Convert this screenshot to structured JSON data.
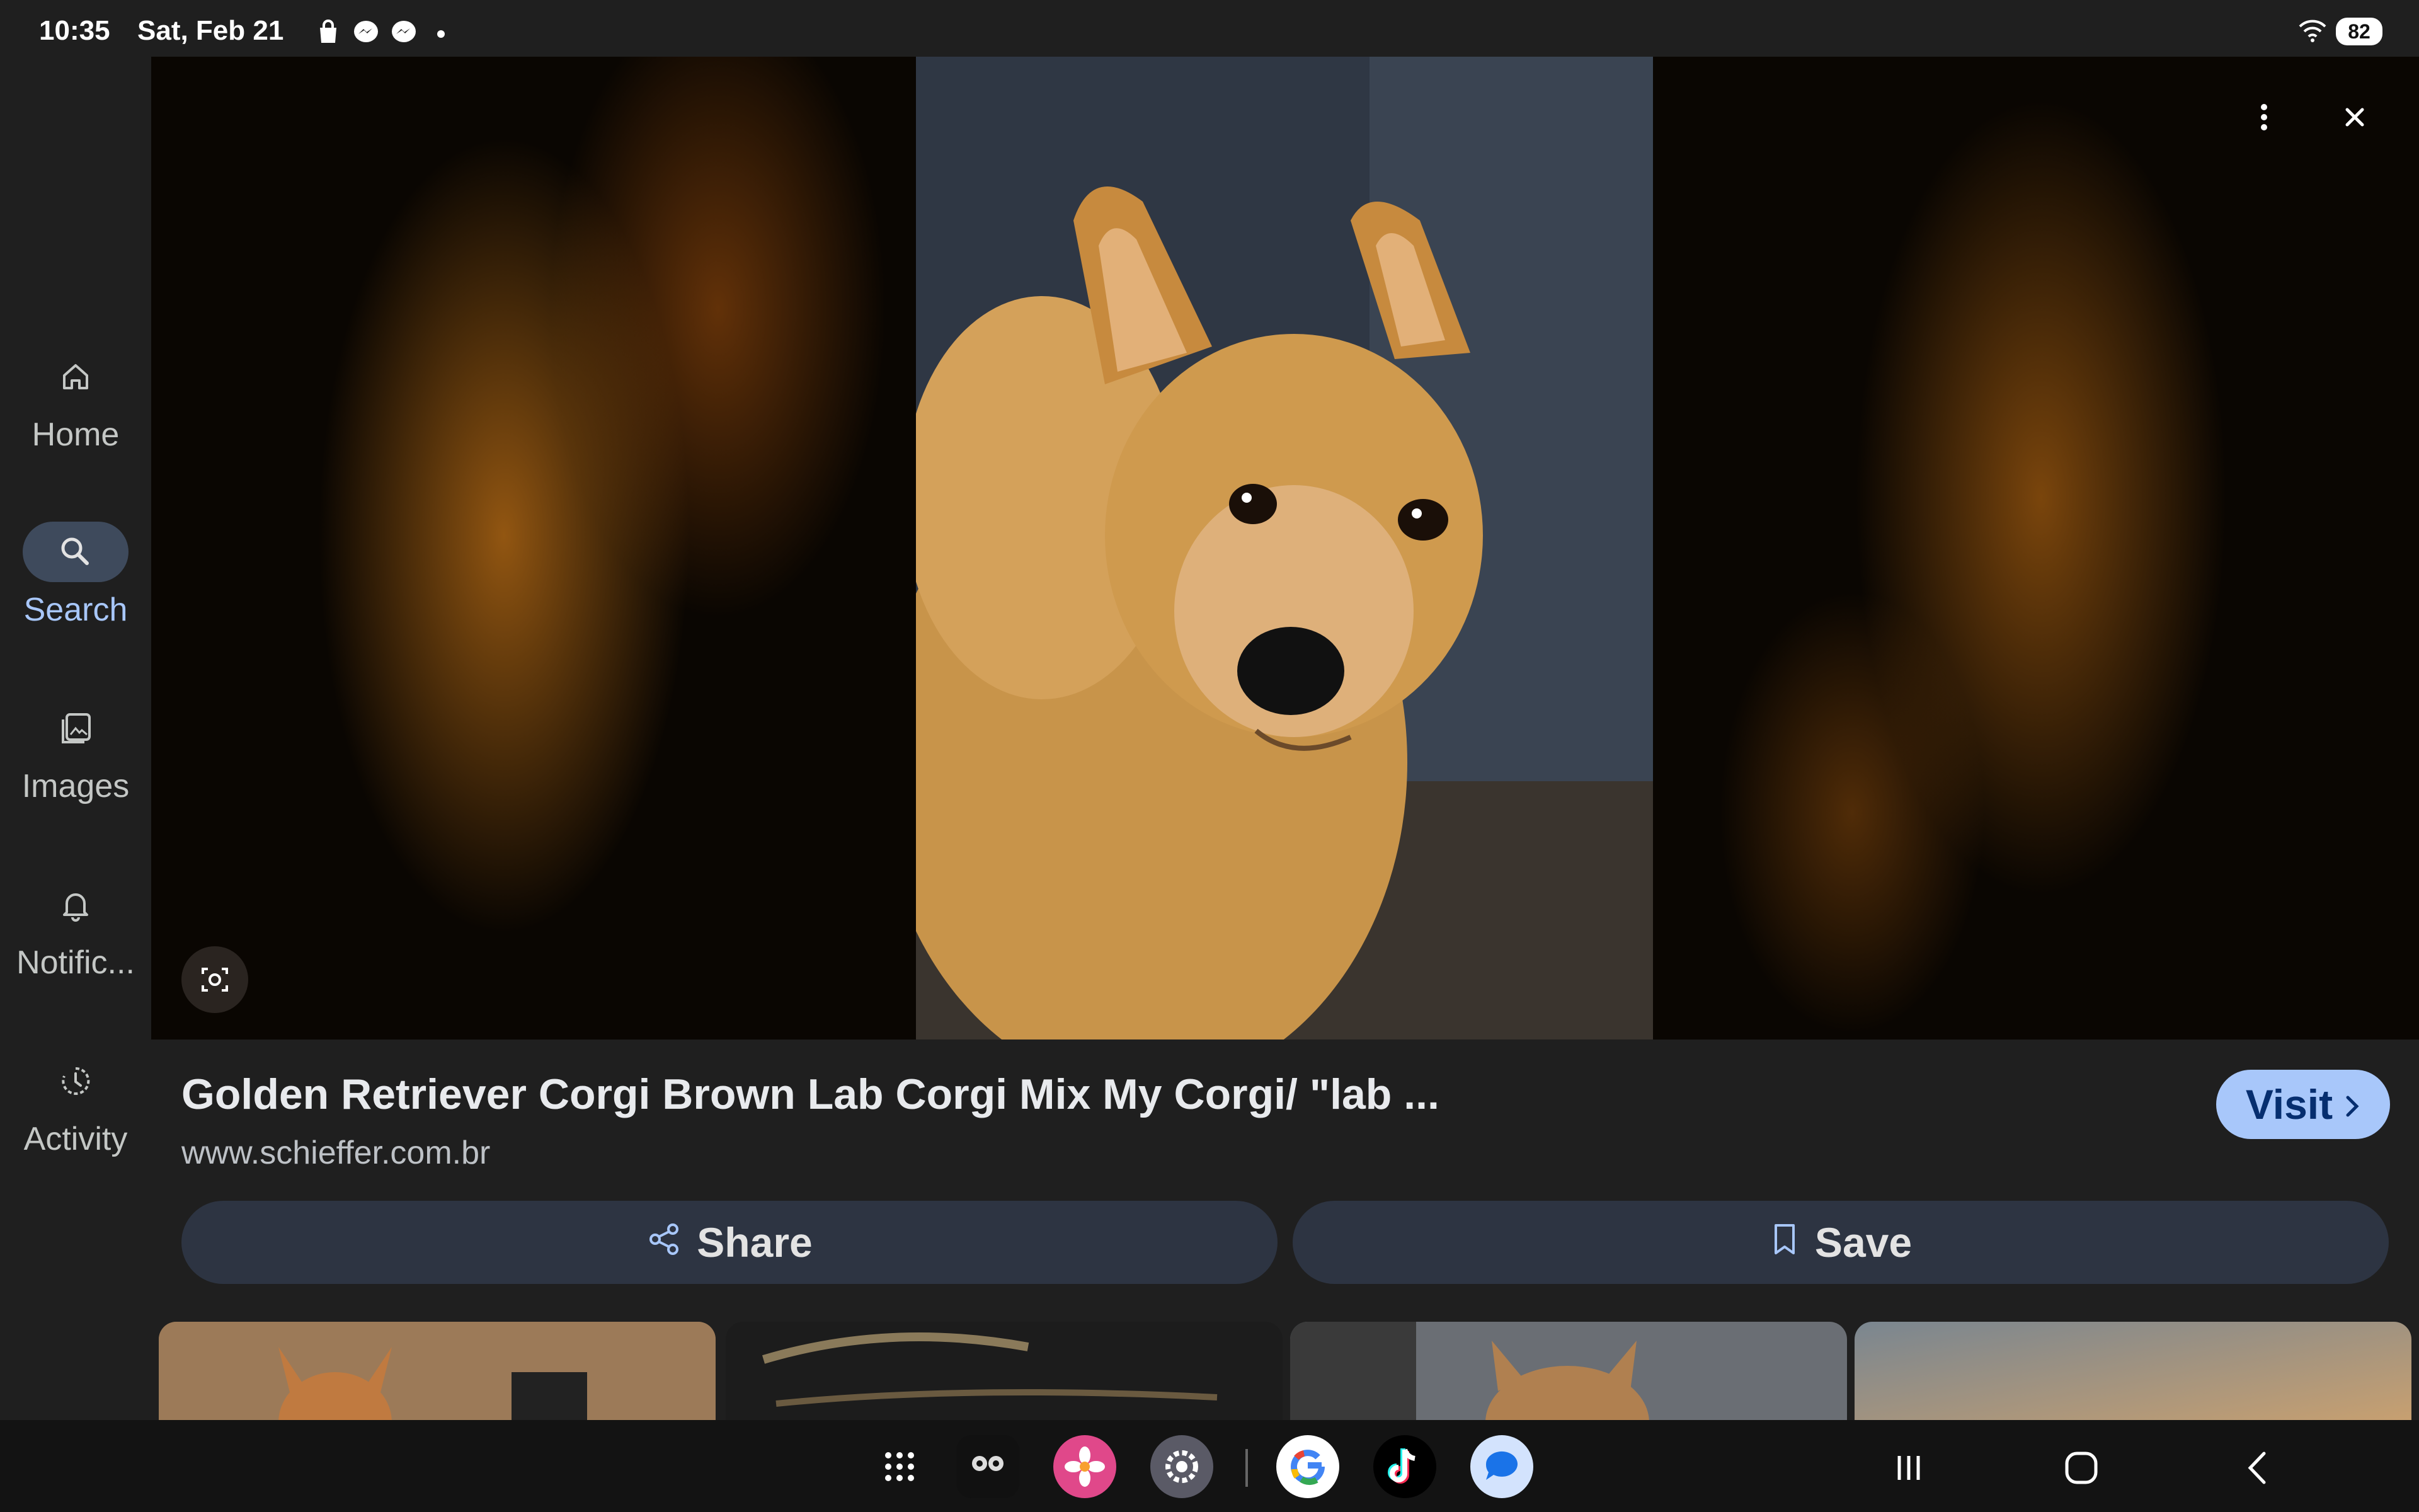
{
  "status_bar": {
    "time": "10:35",
    "date": "Sat, Feb 21",
    "battery": "82",
    "notification_icons": [
      "shopping-bag-icon",
      "messenger-icon",
      "messenger-icon",
      "more-dot-icon"
    ]
  },
  "sidebar": {
    "items": [
      {
        "label": "Home",
        "icon": "home-icon",
        "active": false
      },
      {
        "label": "Search",
        "icon": "search-icon",
        "active": true
      },
      {
        "label": "Images",
        "icon": "images-icon",
        "active": false
      },
      {
        "label": "Notific...",
        "icon": "bell-icon",
        "active": false
      },
      {
        "label": "Activity",
        "icon": "activity-icon",
        "active": false
      }
    ]
  },
  "result": {
    "title": "Golden Retriever Corgi Brown Lab Corgi Mix My Corgi/ \"lab ...",
    "domain": "www.schieffer.com.br",
    "visit_label": "Visit",
    "share_label": "Share",
    "save_label": "Save"
  },
  "dock": {
    "apps": [
      "app-drawer-icon",
      "messenger-kids-icon",
      "photos-icon",
      "settings-icon",
      "google-icon",
      "tiktok-icon",
      "messages-icon"
    ]
  },
  "colors": {
    "accent": "#a8c7fa",
    "background": "#1f1f1f",
    "button": "#2d3442"
  }
}
